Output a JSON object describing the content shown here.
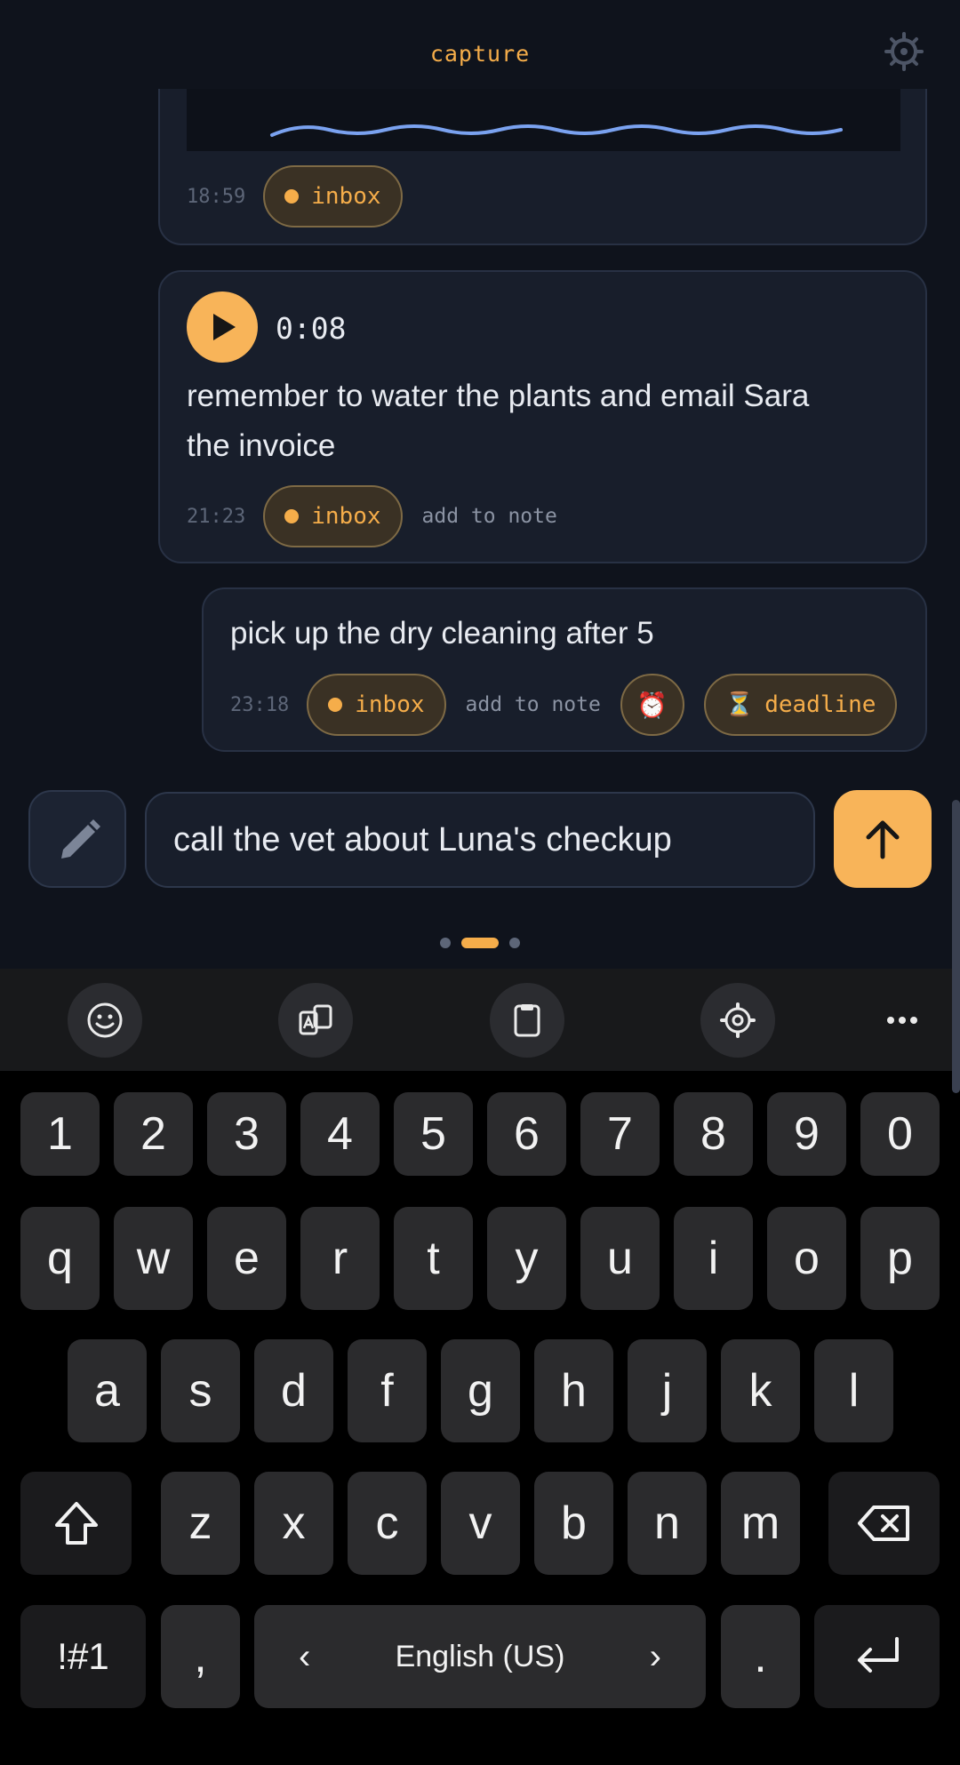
{
  "header": {
    "title": "capture",
    "settings_icon": "settings-cog-icon"
  },
  "colors": {
    "accent": "#f5ad4a",
    "background": "#0f131c",
    "card": "#181e2b"
  },
  "messages": [
    {
      "time": "18:59",
      "tag": "inbox",
      "type": "sketch"
    },
    {
      "time": "21:23",
      "tag": "inbox",
      "type": "voice",
      "duration": "0:08",
      "text_line1": "remember to water the plants and email Sara",
      "text_line2": "the invoice",
      "action": "add to note"
    },
    {
      "time": "23:18",
      "tag": "inbox",
      "type": "text",
      "text": "pick up the dry cleaning after 5",
      "action": "add to note",
      "alarm_glyph": "⏰",
      "deadline_glyph": "⏳",
      "deadline_label": "deadline"
    }
  ],
  "composer": {
    "value": "call the vet about Luna's checkup",
    "placeholder": ""
  },
  "pager": {
    "count": 3,
    "active": 1
  },
  "keyboard": {
    "toolbar": [
      "emoji-icon",
      "translate-icon",
      "clipboard-icon",
      "settings-icon",
      "more-icon"
    ],
    "row_numbers": [
      "1",
      "2",
      "3",
      "4",
      "5",
      "6",
      "7",
      "8",
      "9",
      "0"
    ],
    "row1": [
      "q",
      "w",
      "e",
      "r",
      "t",
      "y",
      "u",
      "i",
      "o",
      "p"
    ],
    "row2": [
      "a",
      "s",
      "d",
      "f",
      "g",
      "h",
      "j",
      "k",
      "l"
    ],
    "row3": [
      "z",
      "x",
      "c",
      "v",
      "b",
      "n",
      "m"
    ],
    "symbols_label": "!#1",
    "comma": ",",
    "period": ".",
    "language": "English (US)",
    "lang_prev": "‹",
    "lang_next": "›"
  }
}
